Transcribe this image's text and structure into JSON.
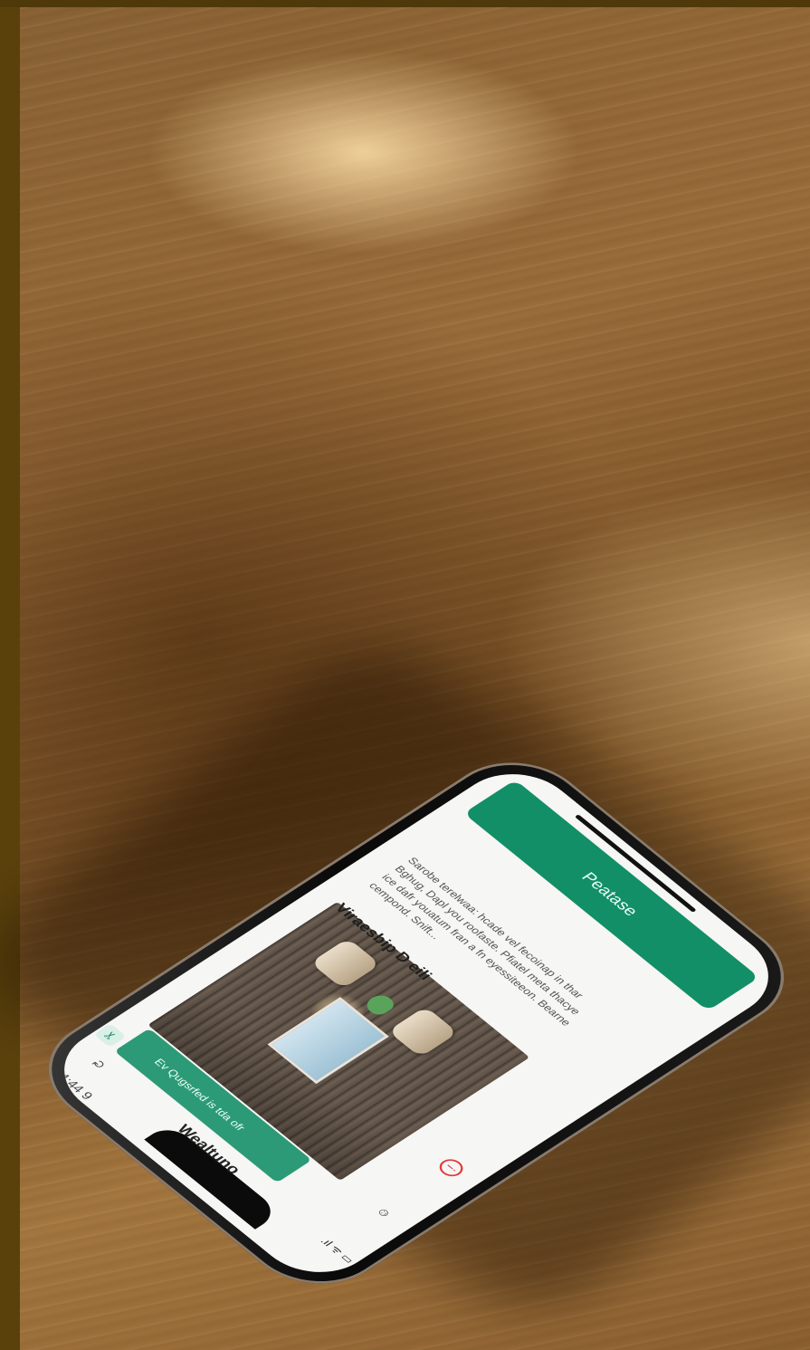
{
  "status_bar": {
    "time": "4:44 9",
    "signal": ".ıl ᯤ ▭"
  },
  "app": {
    "title": "Wealtuno",
    "banner_text": "Ev Qugsrfed is tda ofr"
  },
  "card": {
    "title": "Viraesbip D eili",
    "body": "Sarobe terelwaa: hcade vel fecoinap in thar Bghug, Dapl you roofaste. Pfiatel meta thacye ice dafr youatum fran a fn eyessiteeon. Bearne cempond. Snift..."
  },
  "cta": {
    "label": "Peatase"
  },
  "icons": {
    "refresh": "refresh-icon",
    "bookmark": "bookmark-icon",
    "user": "user-icon",
    "alert": "alert-icon"
  },
  "colors": {
    "accent": "#128f67",
    "banner": "#2c9a76",
    "alert": "#e23b3b",
    "wood": "#9b6d3a"
  }
}
